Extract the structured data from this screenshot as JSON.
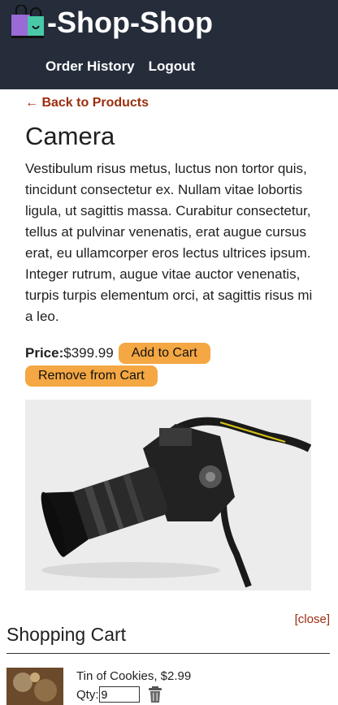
{
  "header": {
    "brand_icon": "shopping-bag-icon",
    "title": "-Shop-Shop",
    "nav": [
      "Order History",
      "Logout"
    ]
  },
  "product": {
    "back_link": "← Back to Products",
    "name": "Camera",
    "description": "Vestibulum risus metus, luctus non tortor quis, tincidunt consectetur ex. Nullam vitae lobortis ligula, ut sagittis massa. Curabitur consectetur, tellus at pulvinar venenatis, erat augue cursus erat, eu ullamcorper eros lectus ultrices ipsum. Integer rutrum, augue vitae auctor venenatis, turpis turpis elementum orci, at sagittis risus mi a leo.",
    "price_label": "Price:",
    "price": "$399.99",
    "add_button": "Add to Cart",
    "remove_button": "Remove from Cart",
    "image": "camera-photo"
  },
  "cart": {
    "close_link": "[close]",
    "title": "Shopping Cart",
    "items": [
      {
        "name": "Tin of Cookies",
        "price": "$2.99",
        "line": "Tin of Cookies, $2.99",
        "qty_label": "Qty:",
        "qty": "9",
        "thumb": "cookies-photo",
        "delete_icon": "trash-icon"
      }
    ]
  },
  "colors": {
    "header_bg": "#252d3b",
    "accent_button": "#f4a742",
    "link": "#9b2e0e"
  }
}
